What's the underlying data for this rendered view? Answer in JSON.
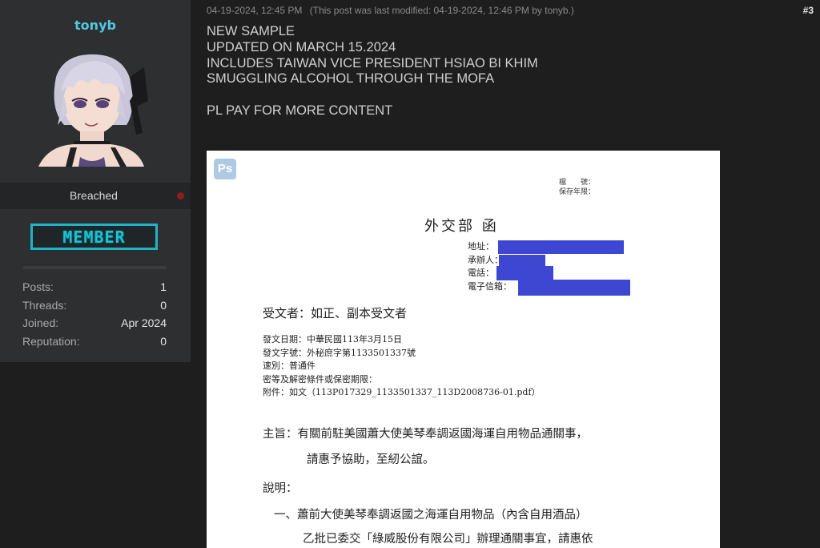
{
  "user": {
    "username": "tonyb",
    "rank": "Breached",
    "badge": "MEMBER",
    "stats": [
      {
        "label": "Posts:",
        "value": "1"
      },
      {
        "label": "Threads:",
        "value": "0"
      },
      {
        "label": "Joined:",
        "value": "Apr 2024"
      },
      {
        "label": "Reputation:",
        "value": "0"
      }
    ]
  },
  "post": {
    "date": "04-19-2024, 12:45 PM",
    "modified": "(This post was last modified: 04-19-2024, 12:46 PM by tonyb.)",
    "number": "#3",
    "lines": [
      "NEW SAMPLE",
      "UPDATED ON MARCH 15.2024",
      "INCLUDES TAIWAN VICE PRESIDENT HSIAO BI KHIM",
      "SMUGGLING ALCOHOL THROUGH THE MOFA"
    ],
    "cta": "PL PAY FOR MORE CONTENT"
  },
  "document": {
    "ps_badge": "Ps",
    "file_meta": [
      "檔　　號：",
      "保存年限："
    ],
    "title": "外交部 函",
    "contact": [
      "地址：",
      "承辦人：",
      "電話：",
      "電子信箱："
    ],
    "recipient": "受文者：如正、副本受文者",
    "meta": [
      "發文日期：中華民國113年3月15日",
      "發文字號：外秘庶字第1133501337號",
      "速別：普通件",
      "密等及解密條件或保密期限：",
      "附件：如文（113P017329_1133501337_113D2008736-01.pdf）"
    ],
    "subject": [
      "主旨：有關前駐美國蕭大使美琴奉調返國海運自用物品通關事，",
      "請惠予協助，至紉公誼。"
    ],
    "explain_label": "說明：",
    "item_one": [
      "一、蕭前大使美琴奉調返國之海運自用物品（內含自用酒品）",
      "乙批已委交「綠威股份有限公司」辦理通關事宜，請惠依"
    ],
    "redaction_color": "#3d47d1"
  }
}
